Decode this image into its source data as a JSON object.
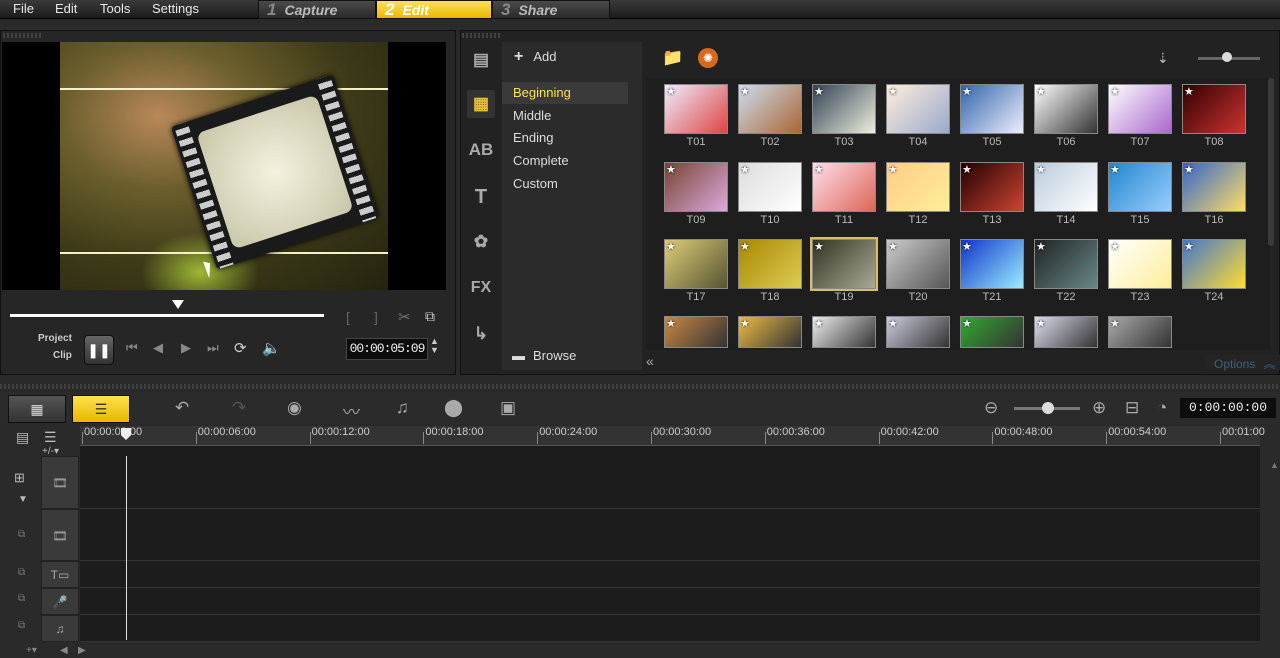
{
  "menu": {
    "file": "File",
    "edit": "Edit",
    "tools": "Tools",
    "settings": "Settings"
  },
  "steps": [
    {
      "num": "1",
      "label": "Capture"
    },
    {
      "num": "2",
      "label": "Edit"
    },
    {
      "num": "3",
      "label": "Share"
    }
  ],
  "player": {
    "project_label": "Project",
    "clip_label": "Clip",
    "timecode": "00:00:05:09",
    "play_icon": "pause-icon"
  },
  "library": {
    "add_label": "Add",
    "browse_label": "Browse",
    "options_label": "Options",
    "categories": [
      "Beginning",
      "Middle",
      "Ending",
      "Complete",
      "Custom"
    ],
    "selected_category": "Beginning",
    "thumbnails": [
      "T01",
      "T02",
      "T03",
      "T04",
      "T05",
      "T06",
      "T07",
      "T08",
      "T09",
      "T10",
      "T11",
      "T12",
      "T13",
      "T14",
      "T15",
      "T16",
      "T17",
      "T18",
      "T19",
      "T20",
      "T21",
      "T22",
      "T23",
      "T24"
    ],
    "selected_thumbnail": "T19"
  },
  "timeline": {
    "timecode": "0:00:00:00",
    "ruler": [
      "00:00:00:00",
      "00:00:06:00",
      "00:00:12:00",
      "00:00:18:00",
      "00:00:24:00",
      "00:00:30:00",
      "00:00:36:00",
      "00:00:42:00",
      "00:00:48:00",
      "00:00:54:00",
      "00:01:00"
    ]
  }
}
